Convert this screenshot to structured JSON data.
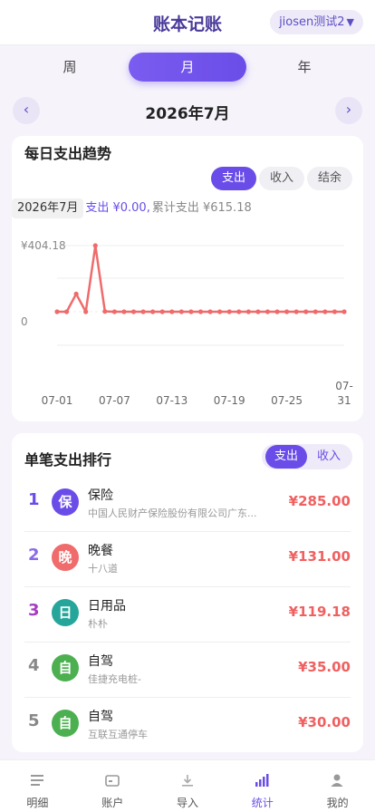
{
  "header": {
    "title": "账本记账",
    "ledger_name": "jiosen测试2",
    "ledger_caret": "▼"
  },
  "period_tabs": [
    {
      "label": "周",
      "active": false
    },
    {
      "label": "月",
      "active": true
    },
    {
      "label": "年",
      "active": false
    }
  ],
  "month_nav": {
    "prev": "‹",
    "label": "2026年7月",
    "next": "›"
  },
  "trend": {
    "title": "每日支出趋势",
    "toggles": [
      "支出",
      "收入",
      "结余"
    ],
    "active_toggle": "支出",
    "summary": {
      "month": "2026年7月",
      "expense_text": "支出 ¥0.00,",
      "cumulative_text": "累计支出 ¥615.18"
    }
  },
  "chart_data": {
    "type": "line",
    "series": [
      {
        "values": [
          0,
          0,
          109,
          0,
          404.18,
          2,
          0,
          0,
          0,
          0,
          0,
          0,
          0,
          0,
          0,
          0,
          0,
          0,
          0,
          0,
          0,
          0,
          0,
          0,
          0,
          0,
          0,
          0,
          0,
          0,
          0
        ],
        "color": "#ef6b6b"
      }
    ],
    "x": [
      "07-01",
      "07-02",
      "07-03",
      "07-04",
      "07-05",
      "07-06",
      "07-07",
      "07-08",
      "07-09",
      "07-10",
      "07-11",
      "07-12",
      "07-13",
      "07-14",
      "07-15",
      "07-16",
      "07-17",
      "07-18",
      "07-19",
      "07-20",
      "07-21",
      "07-22",
      "07-23",
      "07-24",
      "07-25",
      "07-26",
      "07-27",
      "07-28",
      "07-29",
      "07-30",
      "07-31"
    ],
    "x_tick_labels": [
      "07-01",
      "07-07",
      "07-13",
      "07-19",
      "07-25",
      "07-31"
    ],
    "y_tick_labels": [
      "¥404.18",
      "0"
    ],
    "ylim": [
      -200,
      404.18
    ],
    "grid": true
  },
  "ranking": {
    "title": "单笔支出排行",
    "toggles": [
      "支出",
      "收入"
    ],
    "active_toggle": "支出",
    "items": [
      {
        "rank": "1",
        "icon_char": "保",
        "icon_color": "#6a4de8",
        "rank_color": "#6a4de8",
        "name": "保险",
        "desc": "中国人民财产保险股份有限公司广东...",
        "amount": "¥285.00"
      },
      {
        "rank": "2",
        "icon_char": "晚",
        "icon_color": "#f06b6b",
        "rank_color": "#8a6ae6",
        "name": "晚餐",
        "desc": "十八道",
        "amount": "¥131.00"
      },
      {
        "rank": "3",
        "icon_char": "日",
        "icon_color": "#26a69a",
        "rank_color": "#a43ec0",
        "name": "日用品",
        "desc": "朴朴",
        "amount": "¥119.18"
      },
      {
        "rank": "4",
        "icon_char": "自",
        "icon_color": "#4caf50",
        "rank_color": "#888888",
        "name": "自驾",
        "desc": "佳捷充电桩-",
        "amount": "¥35.00"
      },
      {
        "rank": "5",
        "icon_char": "自",
        "icon_color": "#4caf50",
        "rank_color": "#888888",
        "name": "自驾",
        "desc": "互联互通停车",
        "amount": "¥30.00"
      }
    ]
  },
  "bottom_nav": [
    {
      "label": "明细",
      "icon": "list-icon",
      "active": false
    },
    {
      "label": "账户",
      "icon": "wallet-icon",
      "active": false
    },
    {
      "label": "导入",
      "icon": "download-icon",
      "active": false
    },
    {
      "label": "统计",
      "icon": "bar-chart-icon",
      "active": true
    },
    {
      "label": "我的",
      "icon": "user-icon",
      "active": false
    }
  ],
  "colors": {
    "accent": "#6a4de8",
    "expense_red": "#f06060"
  }
}
